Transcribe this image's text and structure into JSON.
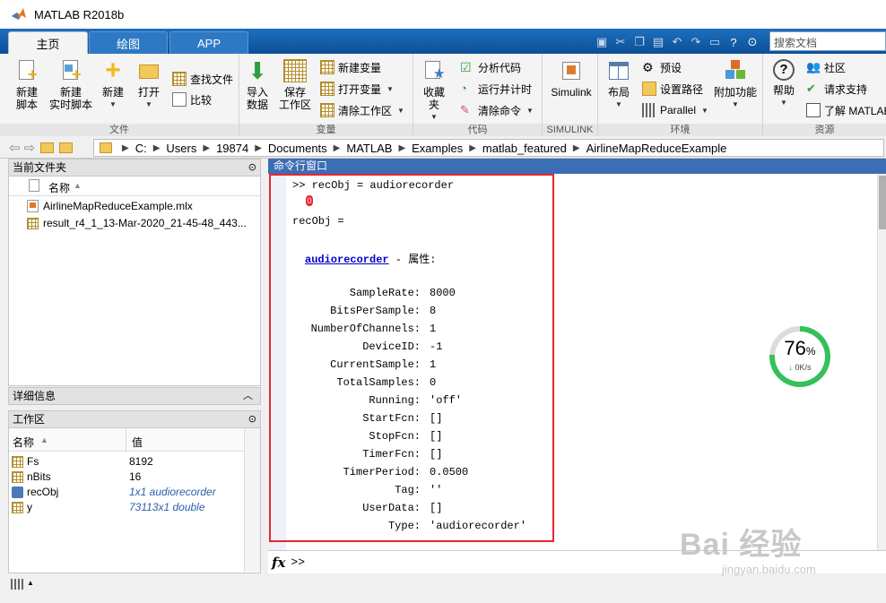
{
  "window": {
    "title": "MATLAB R2018b"
  },
  "tabs": [
    {
      "label": "主页"
    },
    {
      "label": "绘图"
    },
    {
      "label": "APP"
    }
  ],
  "search": {
    "placeholder": "搜索文档"
  },
  "ribbon": {
    "file": {
      "label": "文件",
      "new_script": "新建\n脚本",
      "new_live_script": "新建\n实时脚本",
      "new": "新建",
      "open": "打开",
      "find_files": "查找文件",
      "compare": "比较"
    },
    "variable": {
      "label": "变量",
      "import": "导入\n数据",
      "save_ws": "保存\n工作区",
      "new_var": "新建变量",
      "open_var": "打开变量",
      "clear_ws": "清除工作区"
    },
    "code": {
      "label": "代码",
      "favorites": "收藏夹",
      "analyze": "分析代码",
      "run_time": "运行并计时",
      "clear_cmd": "清除命令"
    },
    "simulink": {
      "label": "SIMULINK",
      "simulink": "Simulink"
    },
    "env": {
      "label": "环境",
      "layout": "布局",
      "prefs": "预设",
      "set_path": "设置路径",
      "parallel": "Parallel",
      "addons": "附加功能"
    },
    "resources": {
      "label": "资源",
      "help": "帮助",
      "community": "社区",
      "support": "请求支持",
      "learn": "了解 MATLAB"
    }
  },
  "breadcrumbs": [
    "C:",
    "Users",
    "19874",
    "Documents",
    "MATLAB",
    "Examples",
    "matlab_featured",
    "AirlineMapReduceExample"
  ],
  "current_folder": {
    "title": "当前文件夹",
    "col_name": "名称",
    "files": [
      "AirlineMapReduceExample.mlx",
      "result_r4_1_13-Mar-2020_21-45-48_443..."
    ]
  },
  "details": {
    "title": "详细信息"
  },
  "workspace": {
    "title": "工作区",
    "col_name": "名称",
    "col_value": "值",
    "rows": [
      {
        "name": "Fs",
        "value": "8192"
      },
      {
        "name": "nBits",
        "value": "16"
      },
      {
        "name": "recObj",
        "value": "1x1 audiorecorder"
      },
      {
        "name": "y",
        "value": "73113x1 double"
      }
    ]
  },
  "command_window": {
    "title": "命令行窗口",
    "prompt_line": ">> recObj = audiorecorder",
    "marker": "0",
    "output_var": "recObj =",
    "class_link": "audiorecorder",
    "class_suffix": " - 属性:",
    "properties": [
      {
        "name": "SampleRate:",
        "value": "8000"
      },
      {
        "name": "BitsPerSample:",
        "value": "8"
      },
      {
        "name": "NumberOfChannels:",
        "value": "1"
      },
      {
        "name": "DeviceID:",
        "value": "-1"
      },
      {
        "name": "CurrentSample:",
        "value": "1"
      },
      {
        "name": "TotalSamples:",
        "value": "0"
      },
      {
        "name": "Running:",
        "value": "'off'"
      },
      {
        "name": "StartFcn:",
        "value": "[]"
      },
      {
        "name": "StopFcn:",
        "value": "[]"
      },
      {
        "name": "TimerFcn:",
        "value": "[]"
      },
      {
        "name": "TimerPeriod:",
        "value": "0.0500"
      },
      {
        "name": "Tag:",
        "value": "''"
      },
      {
        "name": "UserData:",
        "value": "[]"
      },
      {
        "name": "Type:",
        "value": "'audiorecorder'"
      }
    ],
    "fx": "fx",
    "input_prompt": ">>"
  },
  "speed_widget": {
    "percent": "76",
    "percent_sign": "%",
    "rate": "0K/s",
    "level": 0.76
  },
  "watermark": {
    "brand": "Bai 经验",
    "url": "jingyan.baidu.com"
  },
  "colors": {
    "accent": "#0d5aa7",
    "highlight_box": "#e8262c",
    "cmd_header": "#3c6eb4"
  }
}
